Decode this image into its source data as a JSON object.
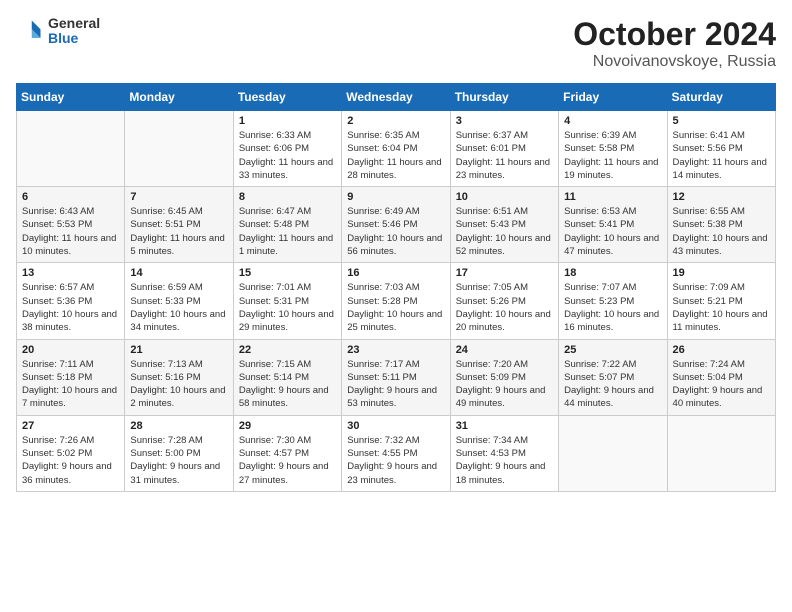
{
  "logo": {
    "general": "General",
    "blue": "Blue"
  },
  "header": {
    "month": "October 2024",
    "location": "Novoivanovskoye, Russia"
  },
  "weekdays": [
    "Sunday",
    "Monday",
    "Tuesday",
    "Wednesday",
    "Thursday",
    "Friday",
    "Saturday"
  ],
  "weeks": [
    [
      {
        "day": "",
        "sunrise": "",
        "sunset": "",
        "daylight": ""
      },
      {
        "day": "",
        "sunrise": "",
        "sunset": "",
        "daylight": ""
      },
      {
        "day": "1",
        "sunrise": "Sunrise: 6:33 AM",
        "sunset": "Sunset: 6:06 PM",
        "daylight": "Daylight: 11 hours and 33 minutes."
      },
      {
        "day": "2",
        "sunrise": "Sunrise: 6:35 AM",
        "sunset": "Sunset: 6:04 PM",
        "daylight": "Daylight: 11 hours and 28 minutes."
      },
      {
        "day": "3",
        "sunrise": "Sunrise: 6:37 AM",
        "sunset": "Sunset: 6:01 PM",
        "daylight": "Daylight: 11 hours and 23 minutes."
      },
      {
        "day": "4",
        "sunrise": "Sunrise: 6:39 AM",
        "sunset": "Sunset: 5:58 PM",
        "daylight": "Daylight: 11 hours and 19 minutes."
      },
      {
        "day": "5",
        "sunrise": "Sunrise: 6:41 AM",
        "sunset": "Sunset: 5:56 PM",
        "daylight": "Daylight: 11 hours and 14 minutes."
      }
    ],
    [
      {
        "day": "6",
        "sunrise": "Sunrise: 6:43 AM",
        "sunset": "Sunset: 5:53 PM",
        "daylight": "Daylight: 11 hours and 10 minutes."
      },
      {
        "day": "7",
        "sunrise": "Sunrise: 6:45 AM",
        "sunset": "Sunset: 5:51 PM",
        "daylight": "Daylight: 11 hours and 5 minutes."
      },
      {
        "day": "8",
        "sunrise": "Sunrise: 6:47 AM",
        "sunset": "Sunset: 5:48 PM",
        "daylight": "Daylight: 11 hours and 1 minute."
      },
      {
        "day": "9",
        "sunrise": "Sunrise: 6:49 AM",
        "sunset": "Sunset: 5:46 PM",
        "daylight": "Daylight: 10 hours and 56 minutes."
      },
      {
        "day": "10",
        "sunrise": "Sunrise: 6:51 AM",
        "sunset": "Sunset: 5:43 PM",
        "daylight": "Daylight: 10 hours and 52 minutes."
      },
      {
        "day": "11",
        "sunrise": "Sunrise: 6:53 AM",
        "sunset": "Sunset: 5:41 PM",
        "daylight": "Daylight: 10 hours and 47 minutes."
      },
      {
        "day": "12",
        "sunrise": "Sunrise: 6:55 AM",
        "sunset": "Sunset: 5:38 PM",
        "daylight": "Daylight: 10 hours and 43 minutes."
      }
    ],
    [
      {
        "day": "13",
        "sunrise": "Sunrise: 6:57 AM",
        "sunset": "Sunset: 5:36 PM",
        "daylight": "Daylight: 10 hours and 38 minutes."
      },
      {
        "day": "14",
        "sunrise": "Sunrise: 6:59 AM",
        "sunset": "Sunset: 5:33 PM",
        "daylight": "Daylight: 10 hours and 34 minutes."
      },
      {
        "day": "15",
        "sunrise": "Sunrise: 7:01 AM",
        "sunset": "Sunset: 5:31 PM",
        "daylight": "Daylight: 10 hours and 29 minutes."
      },
      {
        "day": "16",
        "sunrise": "Sunrise: 7:03 AM",
        "sunset": "Sunset: 5:28 PM",
        "daylight": "Daylight: 10 hours and 25 minutes."
      },
      {
        "day": "17",
        "sunrise": "Sunrise: 7:05 AM",
        "sunset": "Sunset: 5:26 PM",
        "daylight": "Daylight: 10 hours and 20 minutes."
      },
      {
        "day": "18",
        "sunrise": "Sunrise: 7:07 AM",
        "sunset": "Sunset: 5:23 PM",
        "daylight": "Daylight: 10 hours and 16 minutes."
      },
      {
        "day": "19",
        "sunrise": "Sunrise: 7:09 AM",
        "sunset": "Sunset: 5:21 PM",
        "daylight": "Daylight: 10 hours and 11 minutes."
      }
    ],
    [
      {
        "day": "20",
        "sunrise": "Sunrise: 7:11 AM",
        "sunset": "Sunset: 5:18 PM",
        "daylight": "Daylight: 10 hours and 7 minutes."
      },
      {
        "day": "21",
        "sunrise": "Sunrise: 7:13 AM",
        "sunset": "Sunset: 5:16 PM",
        "daylight": "Daylight: 10 hours and 2 minutes."
      },
      {
        "day": "22",
        "sunrise": "Sunrise: 7:15 AM",
        "sunset": "Sunset: 5:14 PM",
        "daylight": "Daylight: 9 hours and 58 minutes."
      },
      {
        "day": "23",
        "sunrise": "Sunrise: 7:17 AM",
        "sunset": "Sunset: 5:11 PM",
        "daylight": "Daylight: 9 hours and 53 minutes."
      },
      {
        "day": "24",
        "sunrise": "Sunrise: 7:20 AM",
        "sunset": "Sunset: 5:09 PM",
        "daylight": "Daylight: 9 hours and 49 minutes."
      },
      {
        "day": "25",
        "sunrise": "Sunrise: 7:22 AM",
        "sunset": "Sunset: 5:07 PM",
        "daylight": "Daylight: 9 hours and 44 minutes."
      },
      {
        "day": "26",
        "sunrise": "Sunrise: 7:24 AM",
        "sunset": "Sunset: 5:04 PM",
        "daylight": "Daylight: 9 hours and 40 minutes."
      }
    ],
    [
      {
        "day": "27",
        "sunrise": "Sunrise: 7:26 AM",
        "sunset": "Sunset: 5:02 PM",
        "daylight": "Daylight: 9 hours and 36 minutes."
      },
      {
        "day": "28",
        "sunrise": "Sunrise: 7:28 AM",
        "sunset": "Sunset: 5:00 PM",
        "daylight": "Daylight: 9 hours and 31 minutes."
      },
      {
        "day": "29",
        "sunrise": "Sunrise: 7:30 AM",
        "sunset": "Sunset: 4:57 PM",
        "daylight": "Daylight: 9 hours and 27 minutes."
      },
      {
        "day": "30",
        "sunrise": "Sunrise: 7:32 AM",
        "sunset": "Sunset: 4:55 PM",
        "daylight": "Daylight: 9 hours and 23 minutes."
      },
      {
        "day": "31",
        "sunrise": "Sunrise: 7:34 AM",
        "sunset": "Sunset: 4:53 PM",
        "daylight": "Daylight: 9 hours and 18 minutes."
      },
      {
        "day": "",
        "sunrise": "",
        "sunset": "",
        "daylight": ""
      },
      {
        "day": "",
        "sunrise": "",
        "sunset": "",
        "daylight": ""
      }
    ]
  ]
}
